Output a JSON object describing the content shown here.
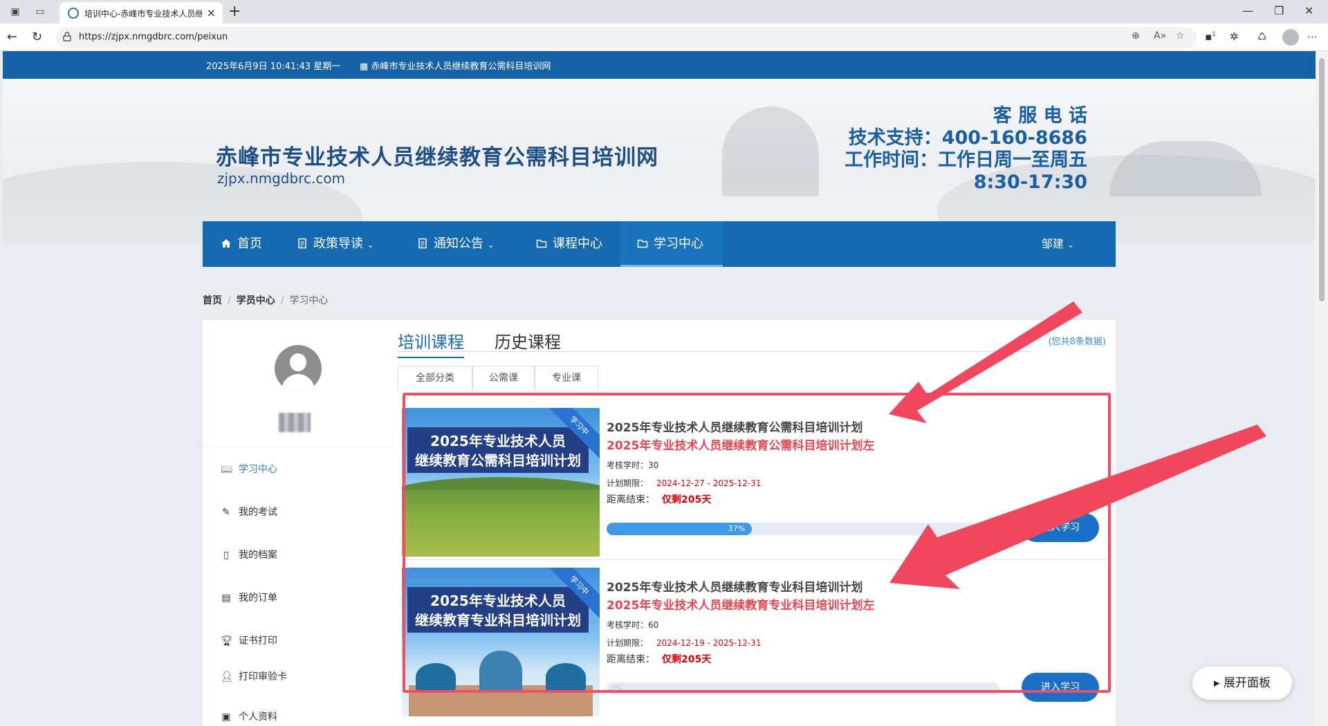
{
  "browser": {
    "tab_title": "培训中心-赤峰市专业技术人员继续教育公需科目培训网",
    "url": "https://zjpx.nmgdbrc.com/peixun",
    "notification_count": "1"
  },
  "topbar": {
    "datetime": "2025年6月9日 10:41:43 星期一",
    "site_link": "▦ 赤峰市专业技术人员继续教育公需科目培训网"
  },
  "banner": {
    "title": "赤峰市专业技术人员继续教育公需科目培训网",
    "domain": "zjpx.nmgdbrc.com",
    "hotline_label": "客 服 电 话",
    "support": "技术支持：400-160-8686",
    "hours": "工作时间：工作日周一至周五",
    "time": "8:30-17:30"
  },
  "nav": {
    "items": [
      {
        "label": "首页",
        "icon": "home-icon"
      },
      {
        "label": "政策导读",
        "icon": "document-icon",
        "dropdown": true
      },
      {
        "label": "通知公告",
        "icon": "document-icon",
        "dropdown": true
      },
      {
        "label": "课程中心",
        "icon": "folder-icon"
      },
      {
        "label": "学习中心",
        "icon": "folder-open-icon",
        "active": true
      }
    ],
    "user": "邹建"
  },
  "breadcrumb": {
    "home": "首页",
    "section": "学员中心",
    "current": "学习中心"
  },
  "sidebar": {
    "menu": [
      {
        "label": "学习中心",
        "icon": "book-icon",
        "active": true
      },
      {
        "label": "我的考试",
        "icon": "edit-icon"
      },
      {
        "label": "我的档案",
        "icon": "archive-icon"
      },
      {
        "label": "我的订单",
        "icon": "clipboard-icon"
      },
      {
        "label": "证书打印",
        "icon": "trophy-icon"
      },
      {
        "label": "打印审验卡",
        "icon": "user-icon"
      },
      {
        "label": "个人资料",
        "icon": "id-card-icon"
      }
    ]
  },
  "panel": {
    "tab_training": "培训课程",
    "tab_history": "历史课程",
    "count": "(您共8条数据)",
    "subtabs": [
      "全部分类",
      "公需课",
      "专业课"
    ]
  },
  "courses": [
    {
      "badge": "学习中",
      "image_title_1": "2025年专业技术人员",
      "image_title_2": "继续教育公需科目培训计划",
      "title": "2025年专业技术人员继续教育公需科目培训计划",
      "subtitle": "2025年专业技术人员继续教育公需科目培训计划左",
      "hours_label": "考核学时：",
      "hours": "30",
      "period_label": "计划期限：",
      "period": "2024-12-27 - 2025-12-31",
      "remain_label": "距离结束：",
      "remain": "仅剩205天",
      "progress": 37,
      "progress_label": "37%",
      "button": "进入学习"
    },
    {
      "badge": "学习中",
      "image_title_1": "2025年专业技术人员",
      "image_title_2": "继续教育专业科目培训计划",
      "title": "2025年专业技术人员继续教育专业科目培训计划",
      "subtitle": "2025年专业技术人员继续教育专业科目培训计划左",
      "hours_label": "考核学时：",
      "hours": "60",
      "period_label": "计划期限：",
      "period": "2024-12-19 - 2025-12-31",
      "remain_label": "距离结束：",
      "remain": "仅剩205天",
      "progress": 0,
      "progress_label": "0%",
      "button": "进入学习"
    }
  ],
  "expand_panel": "展开面板",
  "colors": {
    "brand_blue": "#1469b1",
    "accent_red": "#e30000",
    "highlight": "#ef4f66"
  }
}
